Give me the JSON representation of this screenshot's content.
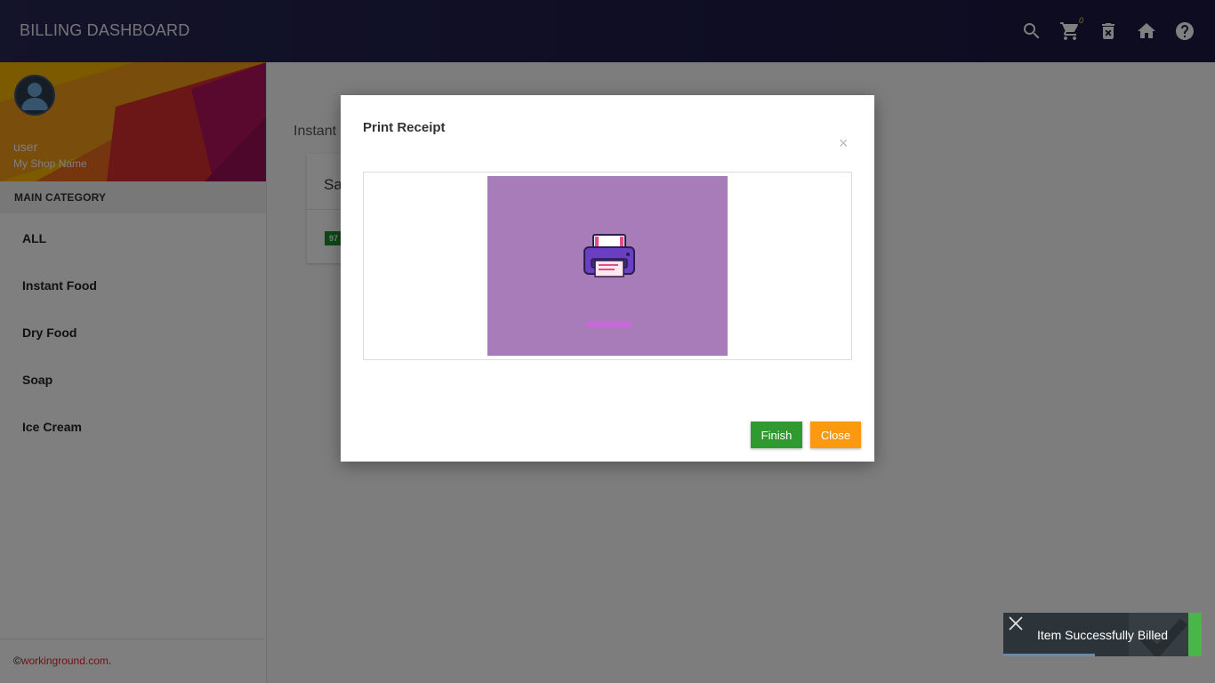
{
  "app": {
    "title": "BILLING DASHBOARD"
  },
  "header": {
    "icons": [
      "search-icon",
      "cart-icon",
      "delete-icon",
      "home-icon",
      "help-icon"
    ],
    "cart_count": "0"
  },
  "sidebar": {
    "user_name": "user",
    "shop_name": "My Shop Name",
    "category_header": "MAIN CATEGORY",
    "items": [
      {
        "label": "ALL"
      },
      {
        "label": "Instant Food"
      },
      {
        "label": "Dry Food"
      },
      {
        "label": "Soap"
      },
      {
        "label": "Ice Cream"
      }
    ],
    "footer": {
      "prefix": "©",
      "link": "workinground.com",
      "suffix": "."
    }
  },
  "main": {
    "breadcrumb": "Instant",
    "card": {
      "name": "Sa",
      "price_badge": "97"
    }
  },
  "modal": {
    "title": "Print Receipt",
    "close_symbol": "×",
    "finish_label": "Finish",
    "close_label": "Close"
  },
  "toast": {
    "message": "Item Successfully Billed",
    "progress": 0.46
  },
  "colors": {
    "header_bg": "#1d1b47",
    "finish": "#2f9a2f",
    "close": "#fb9a10",
    "toast_bg": "#2d3439",
    "toast_stripe": "#4ab54a",
    "preview_bg": "#a77cb8"
  }
}
